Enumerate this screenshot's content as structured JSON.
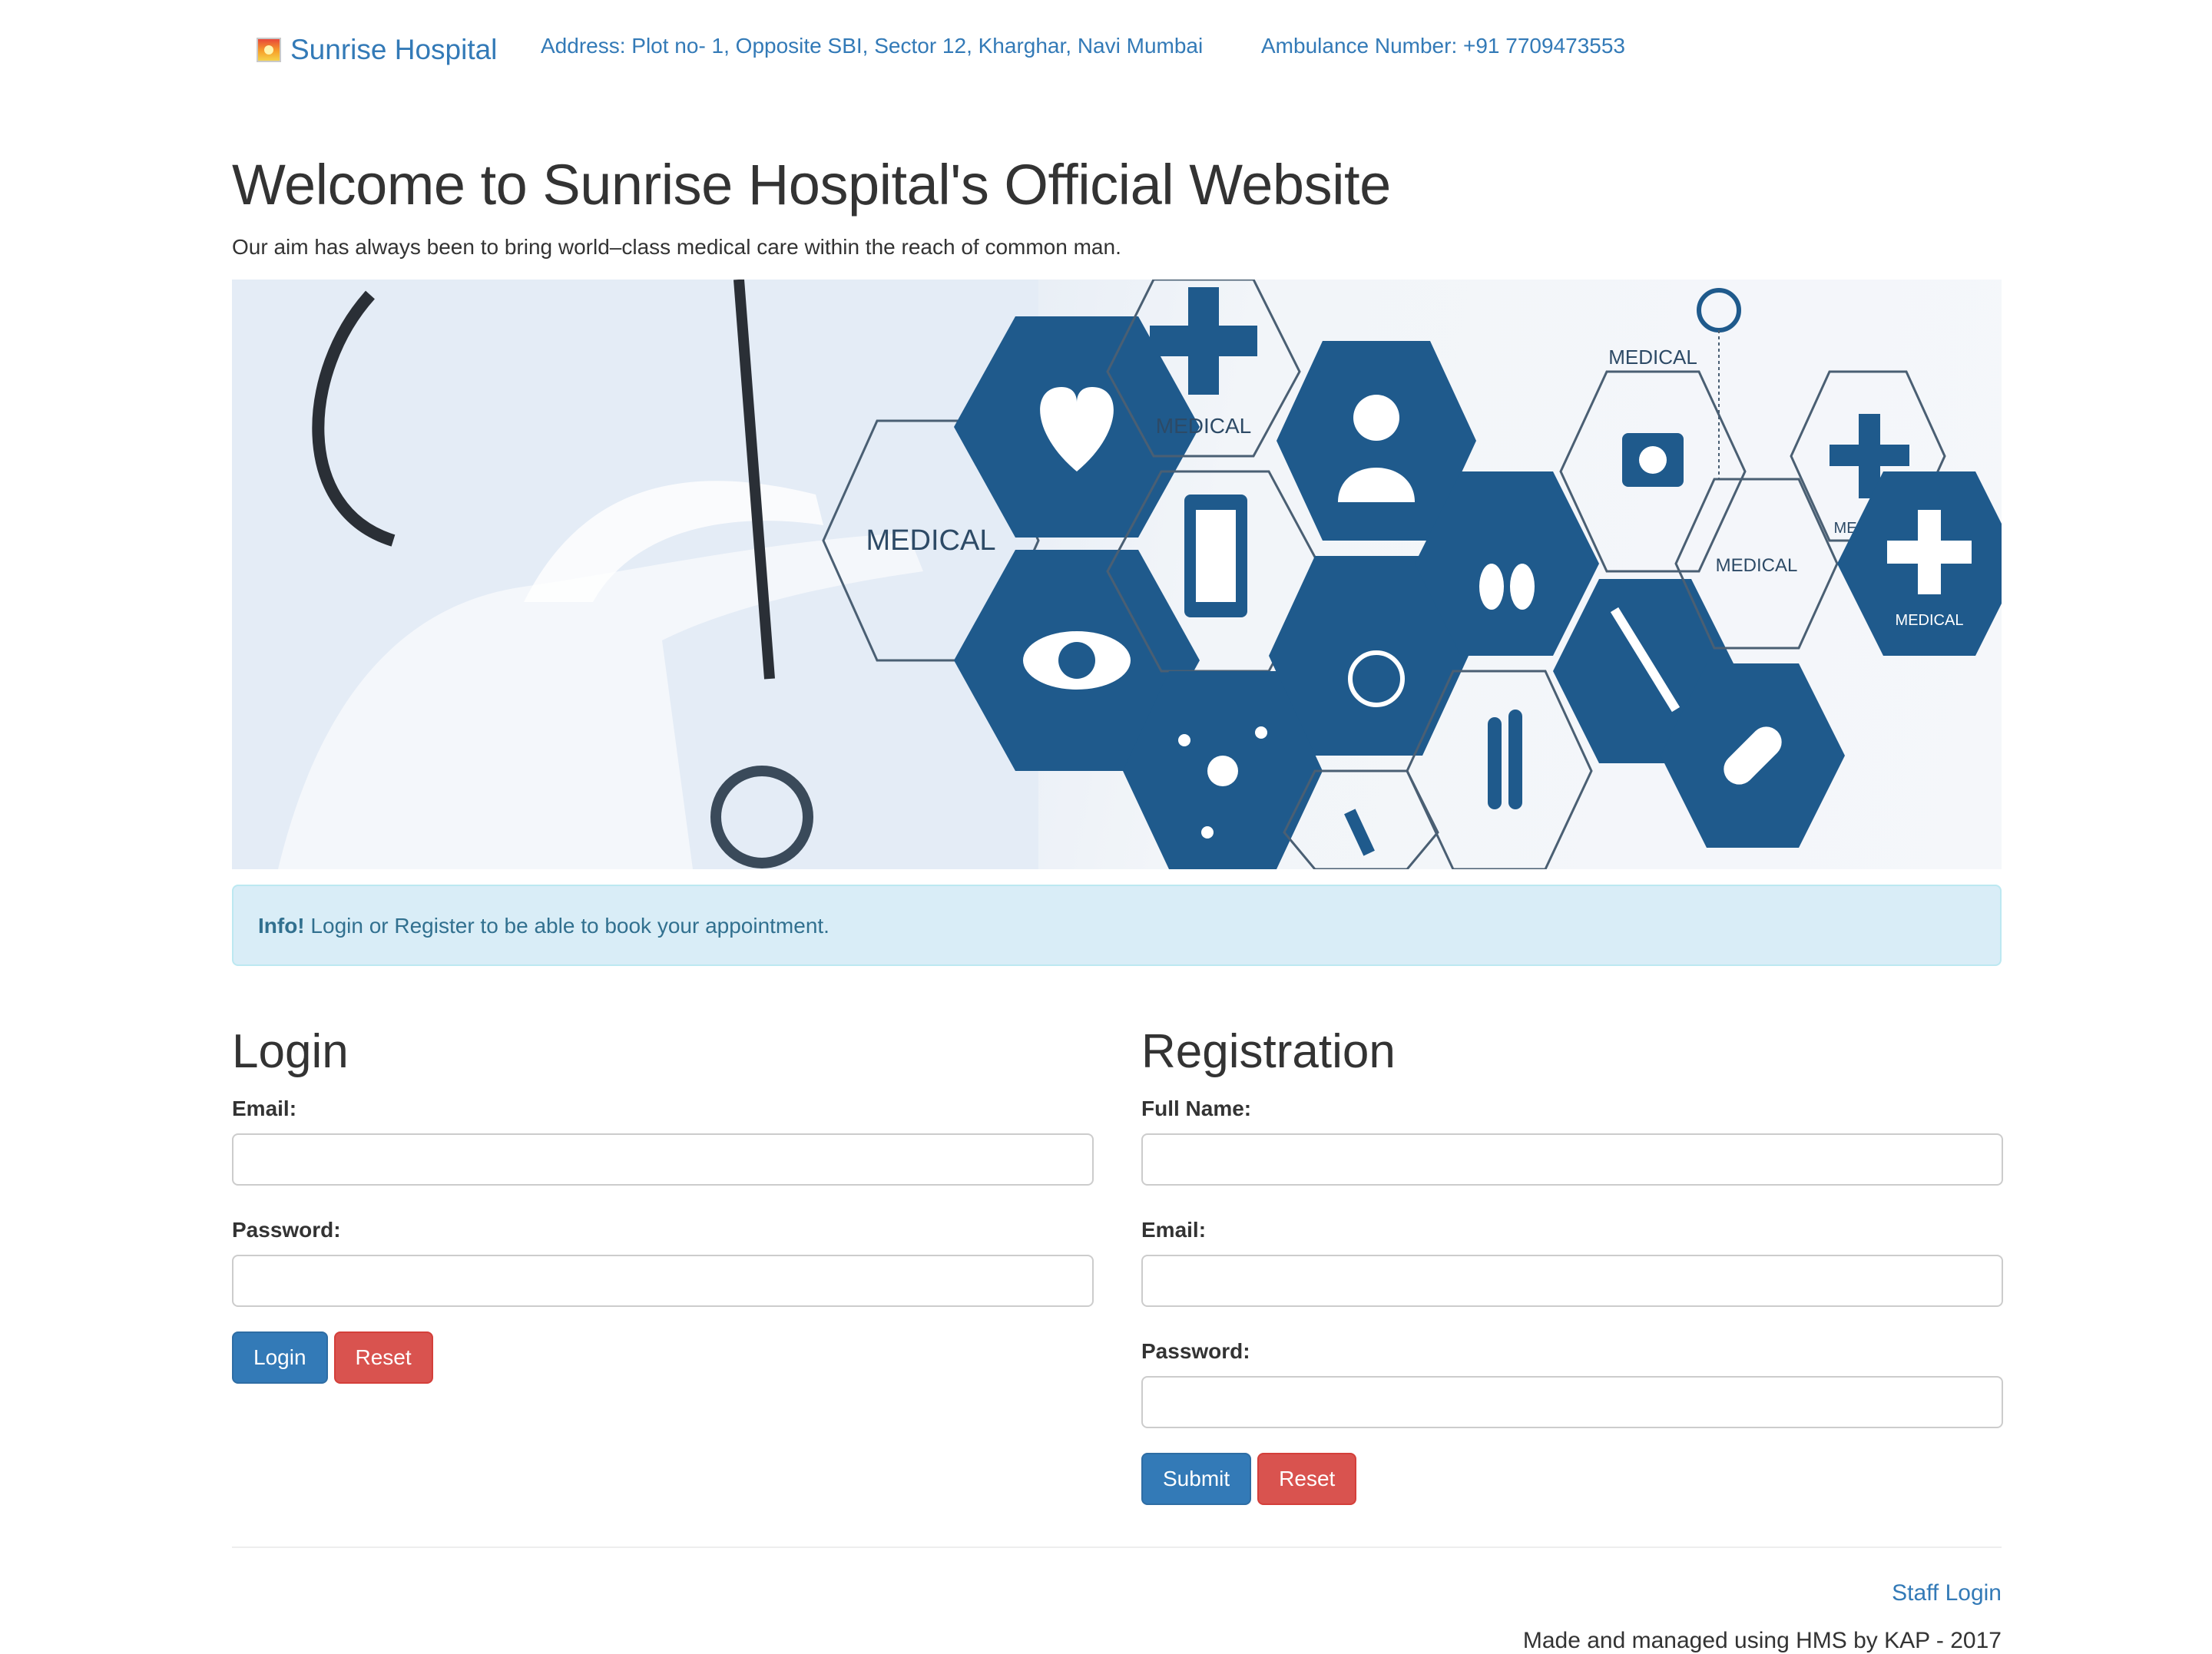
{
  "navbar": {
    "brand": "Sunrise Hospital",
    "brand_icon": "sunrise-icon",
    "address": "Address: Plot no- 1, Opposite SBI, Sector 12, Kharghar, Navi Mumbai",
    "ambulance": "Ambulance Number: +91 7709473553"
  },
  "hero": {
    "title": "Welcome to Sunrise Hospital's Official Website",
    "lead": "Our aim has always been to bring world–class medical care within the reach of common man.",
    "banner": {
      "labels": [
        "MEDICAL",
        "MEDICAL",
        "MEDICAL",
        "MEDICAL",
        "MEDICAL",
        "MEDICAL"
      ],
      "icons": [
        "heart-icon",
        "medical-cross-icon",
        "doctor-icon",
        "medical-kit-icon",
        "clipboard-icon",
        "eye-icon",
        "blood-drops-icon",
        "wheelchair-icon",
        "molecule-icon",
        "test-tubes-icon",
        "syringe-icon",
        "pill-icon",
        "microscope-icon",
        "stethoscope-icon"
      ]
    }
  },
  "alert": {
    "strong": "Info!",
    "text": " Login or Register to be able to book your appointment."
  },
  "login": {
    "title": "Login",
    "email_label": "Email:",
    "password_label": "Password:",
    "login_button": "Login",
    "reset_button": "Reset"
  },
  "registration": {
    "title": "Registration",
    "fullname_label": "Full Name:",
    "email_label": "Email:",
    "password_label": "Password:",
    "submit_button": "Submit",
    "reset_button": "Reset"
  },
  "footer": {
    "staff_login": "Staff Login",
    "made_by": "Made and managed using HMS by KAP - 2017"
  },
  "colors": {
    "link": "#337ab7",
    "primary": "#337ab7",
    "danger": "#d9534f",
    "alert_bg": "#d9edf7",
    "alert_text": "#31708f",
    "hex_blue": "#1f5a8c"
  }
}
